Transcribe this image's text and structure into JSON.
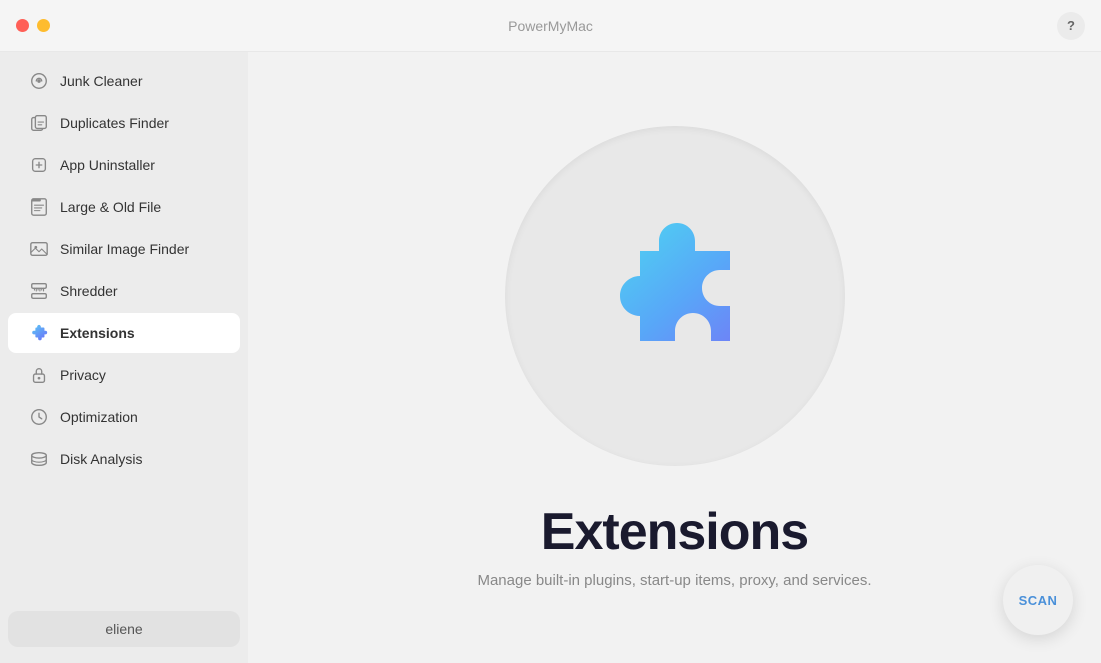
{
  "titlebar": {
    "app_name": "PowerMyMac",
    "help_label": "?"
  },
  "sidebar": {
    "items": [
      {
        "id": "junk-cleaner",
        "label": "Junk Cleaner",
        "icon": "junk-icon",
        "active": false
      },
      {
        "id": "duplicates-finder",
        "label": "Duplicates Finder",
        "icon": "duplicates-icon",
        "active": false
      },
      {
        "id": "app-uninstaller",
        "label": "App Uninstaller",
        "icon": "uninstaller-icon",
        "active": false
      },
      {
        "id": "large-old-file",
        "label": "Large & Old File",
        "icon": "file-icon",
        "active": false
      },
      {
        "id": "similar-image-finder",
        "label": "Similar Image Finder",
        "icon": "image-icon",
        "active": false
      },
      {
        "id": "shredder",
        "label": "Shredder",
        "icon": "shredder-icon",
        "active": false
      },
      {
        "id": "extensions",
        "label": "Extensions",
        "icon": "extensions-icon",
        "active": true
      },
      {
        "id": "privacy",
        "label": "Privacy",
        "icon": "privacy-icon",
        "active": false
      },
      {
        "id": "optimization",
        "label": "Optimization",
        "icon": "optimization-icon",
        "active": false
      },
      {
        "id": "disk-analysis",
        "label": "Disk Analysis",
        "icon": "disk-icon",
        "active": false
      }
    ],
    "user": "eliene"
  },
  "content": {
    "title": "Extensions",
    "subtitle": "Manage built-in plugins, start-up items, proxy, and services.",
    "scan_label": "SCAN"
  }
}
